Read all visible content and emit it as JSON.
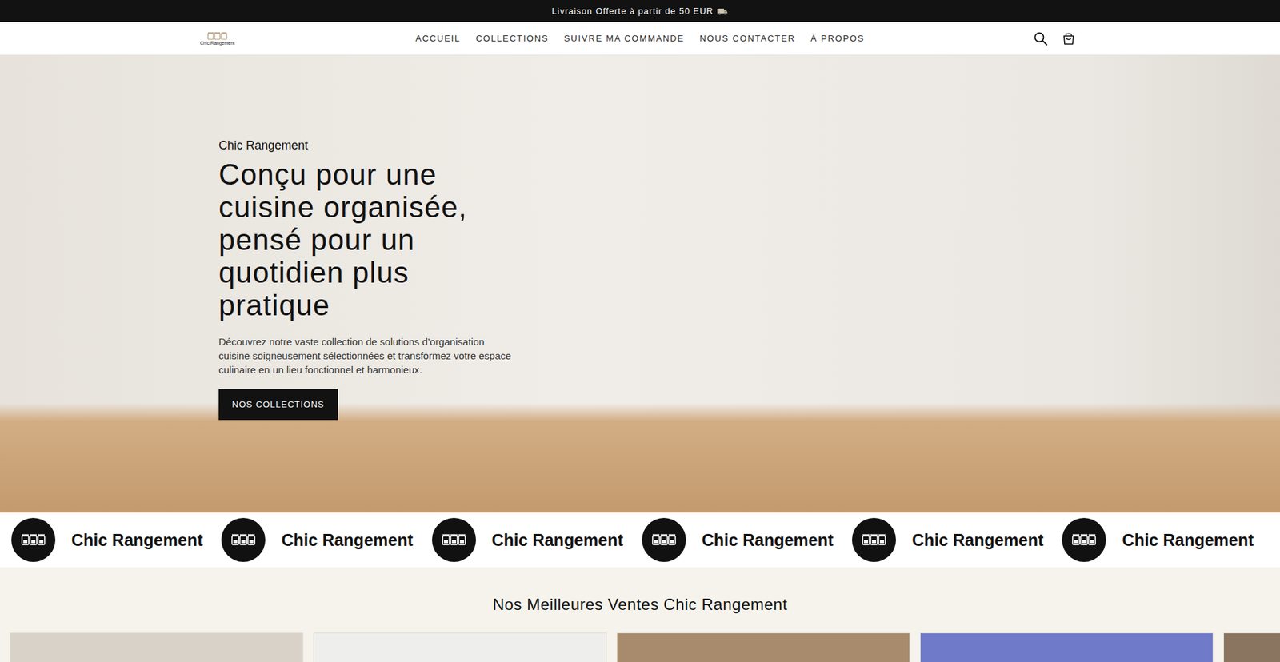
{
  "announcement": {
    "text": "Livraison Offerte à partir de 50 EUR"
  },
  "header": {
    "logo_text": "Chic Rangement",
    "nav": [
      "ACCUEIL",
      "COLLECTIONS",
      "SUIVRE MA COMMANDE",
      "NOUS CONTACTER",
      "À PROPOS"
    ]
  },
  "hero": {
    "eyebrow": "Chic Rangement",
    "heading": "Conçu pour une cuisine organisée, pensé pour un quotidien plus pratique",
    "text": "Découvrez notre vaste collection de solutions d’organisation cuisine soigneusement sélectionnées et transformez votre espace culinaire en un lieu fonctionnel et harmonieux.",
    "button": "NOS COLLECTIONS"
  },
  "marquee": {
    "items": [
      "Chic Rangement",
      "Chic Rangement",
      "Chic Rangement",
      "Chic Rangement",
      "Chic Rangement",
      "Chic Rangement"
    ]
  },
  "best_sellers": {
    "title": "Nos Meilleures Ventes Chic Rangement",
    "products": [
      {
        "color": "#d8d2c8"
      },
      {
        "color": "#eeeeec"
      },
      {
        "color": "#a88b6c"
      },
      {
        "color": "#6f7ac8"
      },
      {
        "color": "#8a7560"
      }
    ]
  }
}
